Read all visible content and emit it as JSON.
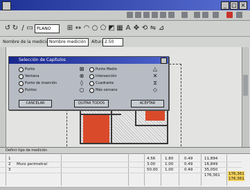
{
  "dialog": {
    "title": "Selección de Capítulos",
    "options_left": [
      "Punto",
      "Ventana",
      "Punto de inserción",
      "Puntos"
    ],
    "options_right": [
      "Punto Medio",
      "Intersección",
      "Cuadrante",
      "Más cercano"
    ],
    "buttons": {
      "cancel": "CANCELAR",
      "deselect_all": "QUITAR TODOS",
      "accept": "ACEPTAR"
    }
  },
  "toolbar": {
    "combo_value": "PLANO"
  },
  "toolbar2": {
    "label_left": "Nombre de la medición",
    "field_value": "Nombre medición",
    "label_right": "Altura",
    "height_value": "2.50"
  },
  "panel": {
    "header": "Definir tipo de medición",
    "rows": [
      {
        "id": "1",
        "name": "",
        "v1": "4.56",
        "v2": "1.80",
        "v3": "0.49",
        "v4": "11,894"
      },
      {
        "id": "2",
        "name": "Muro perimetral",
        "v1": "3.00",
        "v2": "1.00",
        "v3": "0.49",
        "v4": "16,849"
      },
      {
        "id": "3",
        "name": "",
        "v1": "50.00",
        "v2": "1.00",
        "v3": "0.49",
        "v4": "35,050"
      }
    ],
    "subtotal": "176,361",
    "total_right": "176,361",
    "total_right2": "176,361"
  }
}
